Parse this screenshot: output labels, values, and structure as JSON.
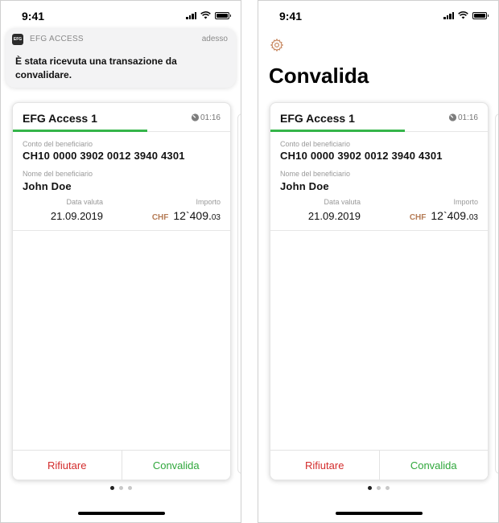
{
  "status_bar": {
    "time": "9:41"
  },
  "notification": {
    "app_icon_text": "EFG",
    "app_name": "EFG ACCESS",
    "time": "adesso",
    "message": "È stata ricevuta una transazione da convalidare."
  },
  "header": {
    "title": "Convalida"
  },
  "card": {
    "title": "EFG Access 1",
    "timer": "01:16",
    "progress_fraction": 0.62,
    "account_label": "Conto del beneficiario",
    "account_value": "CH10 0000 3902 0012 3940 4301",
    "name_label": "Nome del beneficiario",
    "name_value": "John Doe",
    "date_label": "Data valuta",
    "date_value": "21.09.2019",
    "amount_label": "Importo",
    "currency": "CHF",
    "amount_int": "12`409.",
    "amount_dec": "03",
    "reject_label": "Rifiutare",
    "confirm_label": "Convalida"
  },
  "pager": {
    "count": 3,
    "active": 1
  },
  "colors": {
    "progress": "#35b54a",
    "reject": "#d32c2c",
    "confirm": "#2fa73b",
    "currency": "#b57b55"
  }
}
